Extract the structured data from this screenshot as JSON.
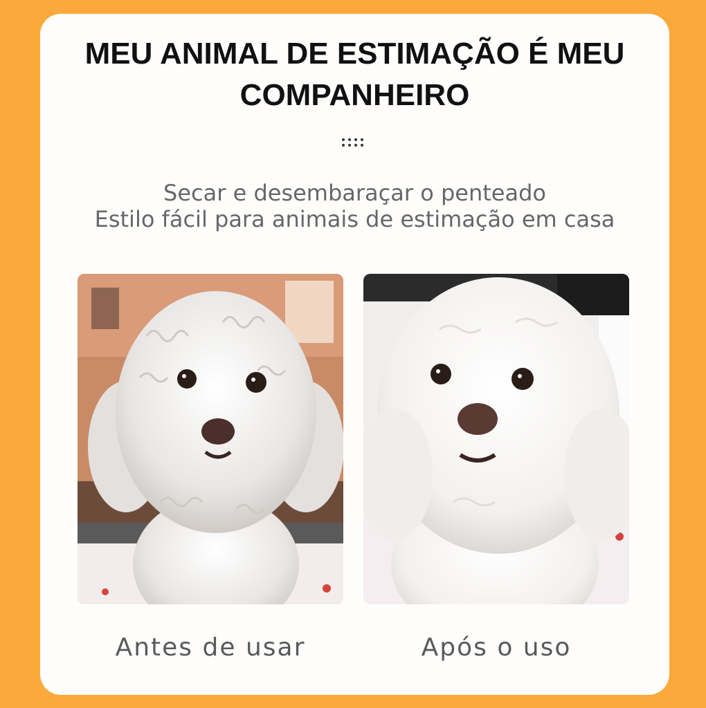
{
  "title": {
    "line1": "MEU ANIMAL DE ESTIMAÇÃO É MEU",
    "line2": "COMPANHEIRO"
  },
  "subtitle": {
    "line1": "Secar e desembaraçar o penteado",
    "line2": "Estilo fácil para animais de estimação em casa"
  },
  "photos": [
    {
      "caption": "Antes de usar",
      "subject": "white-curly-poodle-before"
    },
    {
      "caption": "Após o uso",
      "subject": "white-fluffy-poodle-after"
    }
  ],
  "colors": {
    "background": "#fba93a",
    "card": "#fffefc",
    "title": "#111111",
    "text": "#666666"
  }
}
